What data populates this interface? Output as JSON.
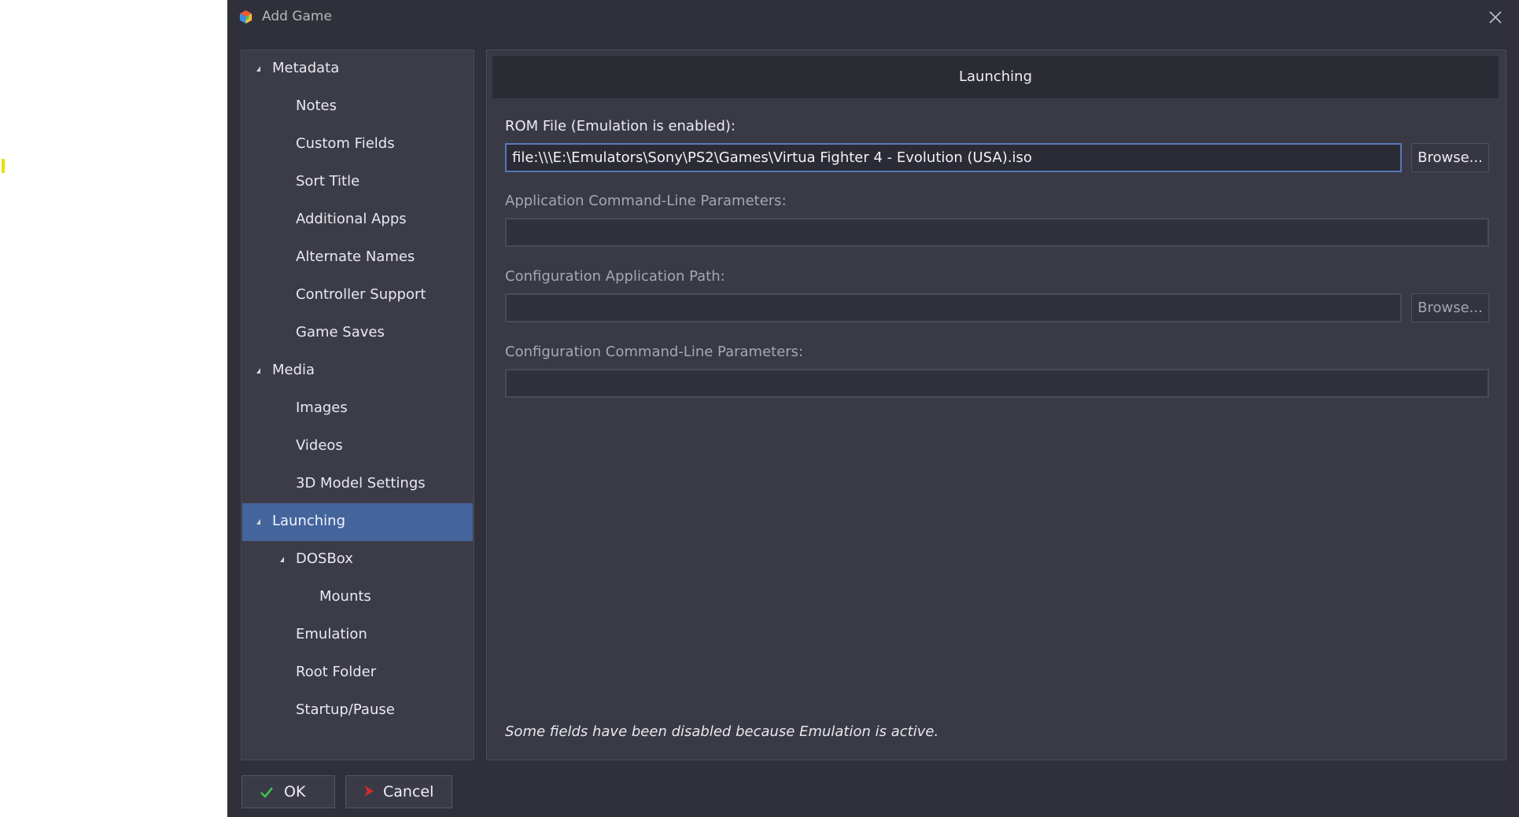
{
  "window": {
    "title": "Add Game",
    "close_icon": "close-icon"
  },
  "sidebar": {
    "items": [
      {
        "label": "Metadata",
        "level": 0,
        "expandable": true
      },
      {
        "label": "Notes",
        "level": 1
      },
      {
        "label": "Custom Fields",
        "level": 1
      },
      {
        "label": "Sort Title",
        "level": 1
      },
      {
        "label": "Additional Apps",
        "level": 1
      },
      {
        "label": "Alternate Names",
        "level": 1
      },
      {
        "label": "Controller Support",
        "level": 1
      },
      {
        "label": "Game Saves",
        "level": 1
      },
      {
        "label": "Media",
        "level": 0,
        "expandable": true
      },
      {
        "label": "Images",
        "level": 1
      },
      {
        "label": "Videos",
        "level": 1
      },
      {
        "label": "3D Model Settings",
        "level": 1
      },
      {
        "label": "Launching",
        "level": 0,
        "expandable": true,
        "selected": true
      },
      {
        "label": "DOSBox",
        "level": 1,
        "expandable": true
      },
      {
        "label": "Mounts",
        "level": 2
      },
      {
        "label": "Emulation",
        "level": 1
      },
      {
        "label": "Root Folder",
        "level": 1
      },
      {
        "label": "Startup/Pause",
        "level": 1
      }
    ]
  },
  "main": {
    "section_title": "Launching",
    "rom_file": {
      "label": "ROM File (Emulation is enabled):",
      "value": "file:\\\\\\E:\\Emulators\\Sony\\PS2\\Games\\Virtua Fighter 4 - Evolution (USA).iso",
      "browse_label": "Browse..."
    },
    "app_cmdline": {
      "label": "Application Command-Line Parameters:",
      "value": ""
    },
    "config_path": {
      "label": "Configuration Application Path:",
      "value": "",
      "browse_label": "Browse..."
    },
    "config_cmdline": {
      "label": "Configuration Command-Line Parameters:",
      "value": ""
    },
    "note": "Some fields have been disabled because Emulation is active."
  },
  "footer": {
    "ok_label": "OK",
    "cancel_label": "Cancel"
  },
  "colors": {
    "dialog_bg": "#2f3039",
    "selected": "#44659c",
    "focus_border": "#5a78b8"
  }
}
